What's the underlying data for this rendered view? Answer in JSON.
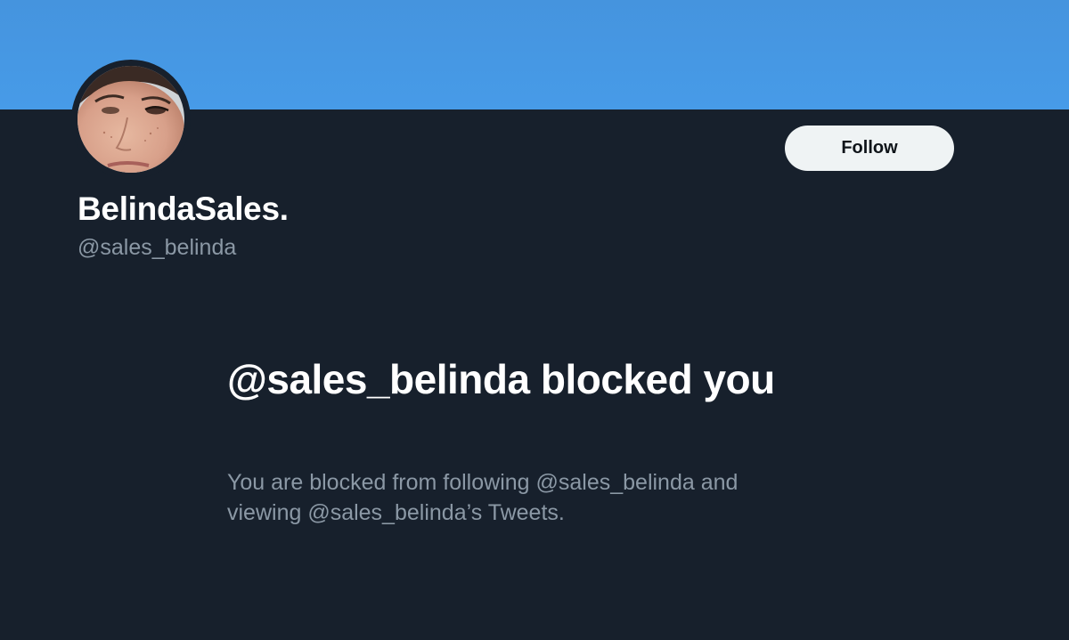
{
  "profile": {
    "display_name": "BelindaSales.",
    "handle": "@sales_belinda",
    "banner_color": "#479be8",
    "avatar_icon": "profile-photo"
  },
  "actions": {
    "follow_label": "Follow"
  },
  "blocked_notice": {
    "title": "@sales_belinda blocked you",
    "description": "You are blocked from following @sales_belinda and viewing @sales_belinda’s Tweets."
  },
  "colors": {
    "background": "#17202c",
    "primary_text": "#ffffff",
    "secondary_text": "#8b98a5",
    "button_bg": "#eff3f4"
  }
}
